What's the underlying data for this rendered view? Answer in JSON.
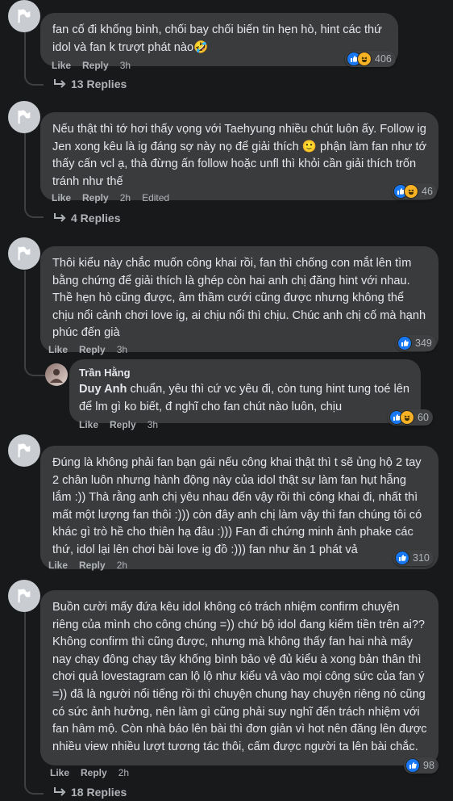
{
  "comments": [
    {
      "text": "fan cố đi khống bình, chối bay chối biến tin hẹn hò, hint các thứ idol và fan k trượt phát nào🤣",
      "like": "Like",
      "reply": "Reply",
      "time": "3h",
      "edited": "",
      "reaction_count": "406",
      "replies": "13 Replies"
    },
    {
      "text": "Nếu thật thì tớ hơi thấy vọng với Taehyung nhiều chút luôn ấy. Follow ig Jen xong kêu là ig đáng sợ này nọ để giải thích 🙂 phận làm fan như tớ thấy cấn vcl ạ, thà đừng ấn follow hoặc unfl thì khỏi cần giải thích trốn tránh như thế",
      "like": "Like",
      "reply": "Reply",
      "time": "2h",
      "edited": "Edited",
      "reaction_count": "46",
      "replies": "4 Replies"
    },
    {
      "text": "Thôi kiểu này chắc muốn công khai rồi, fan thì chống con mắt lên tìm bằng chứng để giải thích là ghép còn hai anh chị đăng hint với nhau. Thề hẹn hò cũng được, âm thầm cưới cũng được nhưng không thể chịu nổi cảnh chơi love ig, ai chịu nổi thì chịu. Chúc anh chị cố mà hạnh phúc đến già",
      "like": "Like",
      "reply": "Reply",
      "time": "3h",
      "reaction_count": "349"
    },
    {
      "text": "Đúng là không phải fan bạn gái nếu công khai thật thì t sẽ ủng hộ 2 tay 2 chân luôn nhưng hành động này của idol thật sự làm fan hụt hẫng lắm :)) Thà rằng anh chị yêu nhau đến vậy rồi thì công khai đi, nhất thì mất một lượng fan thôi :))) còn đây anh chị làm vậy thì fan chúng tôi có khác gì trò hề cho thiên hạ đâu :))) Fan đi chứng minh ảnh phake các thứ, idol lại lên chơi bài love ig đồ :))) fan như ăn 1 phát vả",
      "like": "Like",
      "reply": "Reply",
      "time": "2h",
      "reaction_count": "310"
    },
    {
      "text": "Buồn cười mấy đứa kêu idol không có trách nhiệm confirm chuyện riêng của mình cho công chúng =)) chứ bộ idol đang kiếm tiền trên ai?? Không confirm thì cũng được, nhưng mà không thấy fan hai nhà mấy nay chạy đông chạy tây khống bình bảo vệ đủ kiểu à xong bản thân thì chơi quả lovestagram can lộ lộ như kiểu vả vào mọi công sức của fan ý =)) đã là người nổi tiếng rồi thì chuyện chung hay chuyện riêng nó cũng có sức ảnh hưởng, nên làm gì cũng phải suy nghĩ đến trách nhiệm với fan hâm mộ. Còn nhà báo lên bài thì đơn giản vì hot nên đăng lên được nhiều view nhiều lượt tương tác thôi, cấm được người ta lên bài chắc.",
      "like": "Like",
      "reply": "Reply",
      "time": "2h",
      "reaction_count": "98",
      "replies": "18 Replies"
    }
  ],
  "nested_reply": {
    "author": "Trần Hằng",
    "mention": "Duy Anh",
    "text": " chuẩn, yêu thì cứ vc yêu đi, còn tung hint tung toé lên để lm gì ko biết, đ nghĩ cho fan chút nào luôn, chịu",
    "like": "Like",
    "reply": "Reply",
    "time": "3h",
    "reaction_count": "60"
  },
  "icons": {
    "avatar": "flag-icon",
    "reply_arrow": "reply-arrow-icon",
    "like": "like-icon",
    "haha": "haha-icon"
  },
  "colors": {
    "background": "#18191a",
    "bubble": "#3a3b3c",
    "like": "#1877f2",
    "haha": "#f7b125"
  }
}
